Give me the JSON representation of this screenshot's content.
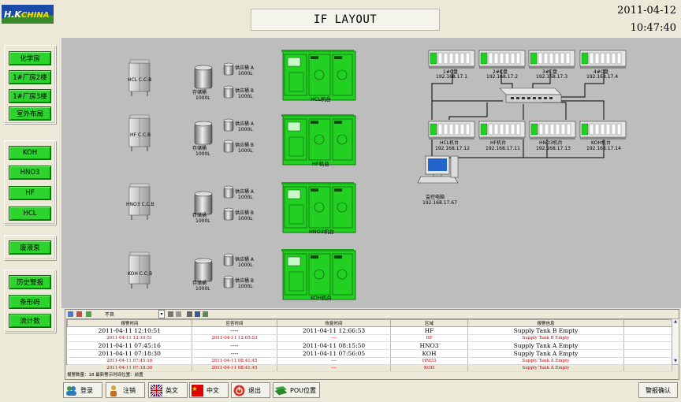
{
  "header": {
    "logo_text": "H.K CHINA",
    "title": "IF LAYOUT",
    "date": "2011-04-12",
    "time": "10:47:40"
  },
  "nav": {
    "group1": [
      "化学房",
      "1#厂房2楼",
      "1#厂房3楼",
      "室外布局"
    ],
    "group2": [
      "KOH",
      "HNO3",
      "HF",
      "HCL"
    ],
    "group3": [
      "废液泵"
    ],
    "group4": [
      "历史警报",
      "条形码",
      "流计数"
    ]
  },
  "layout": {
    "cabinets": [
      "HCL C.C.B",
      "HF C.C.B",
      "HNO3 C.C.B",
      "KOH C.C.B"
    ],
    "storage_label": "存储桶",
    "storage_cap": "1000L",
    "supply_a": "供应桶 A",
    "supply_b": "供应桶 B",
    "supply_cap": "1000L",
    "machines": [
      "HCL机台",
      "HF机台",
      "HNO3机台",
      "KOH机台"
    ]
  },
  "network": {
    "plc_top": [
      {
        "label": "1#C盘",
        "ip": "192.168.17.1"
      },
      {
        "label": "2#C盘",
        "ip": "192.168.17.2"
      },
      {
        "label": "3#C盘",
        "ip": "192.168.17.3"
      },
      {
        "label": "4#C盘",
        "ip": "192.168.17.4"
      }
    ],
    "plc_bottom": [
      {
        "label": "HCL机台",
        "ip": "192.168.17.12"
      },
      {
        "label": "HF机台",
        "ip": "192.168.17.11"
      },
      {
        "label": "HNO3机台",
        "ip": "192.168.17.13"
      },
      {
        "label": "KOH机台",
        "ip": "192.168.17.14"
      }
    ],
    "pc_label": "监控电脑",
    "pc_ip": "192.168.17.67"
  },
  "alarm": {
    "toolbar_filter": "不良",
    "columns": [
      "报警时间",
      "应答时间",
      "恢复时间",
      "区域",
      "报警信息"
    ],
    "rows": [
      {
        "t1": "2011-04-11 12:10:51",
        "t2": "----",
        "t3": "2011-04-11 12:66:53",
        "area": "HF",
        "msg": "Supply Tank B Empty",
        "small": false
      },
      {
        "t1": "2011-04-11 12:10:51",
        "t2": "2011-04-11 12:05:53",
        "t3": "----",
        "area": "HF",
        "msg": "Supply Tank B Empty",
        "small": true
      },
      {
        "t1": "2011-04-11 07:45:16",
        "t2": "----",
        "t3": "2011-04-11 08:15:50",
        "area": "HNO3",
        "msg": "Supply Tank A Empty",
        "small": false
      },
      {
        "t1": "2011-04-11 07:18:30",
        "t2": "----",
        "t3": "2011-04-11 07:56:05",
        "area": "KOH",
        "msg": "Supply Tank A Empty",
        "small": false
      },
      {
        "t1": "2011-04-11 07:45:16",
        "t2": "2011-04-11 08:41:45",
        "t3": "----",
        "area": "HNO3",
        "msg": "Supply Tank A Empty",
        "small": true
      },
      {
        "t1": "2011-04-11 07:18:30",
        "t2": "2011-04-11 08:41:45",
        "t3": "----",
        "area": "KOH",
        "msg": "Supply Tank A Empty",
        "small": true
      }
    ],
    "status": "报警数量：18  最新警示时间位置：前置"
  },
  "toolbar": {
    "login": "登录",
    "logout": "注销",
    "english": "英文",
    "chinese": "中文",
    "exit": "退出",
    "pou": "POU位置",
    "ack": "警报确认"
  }
}
